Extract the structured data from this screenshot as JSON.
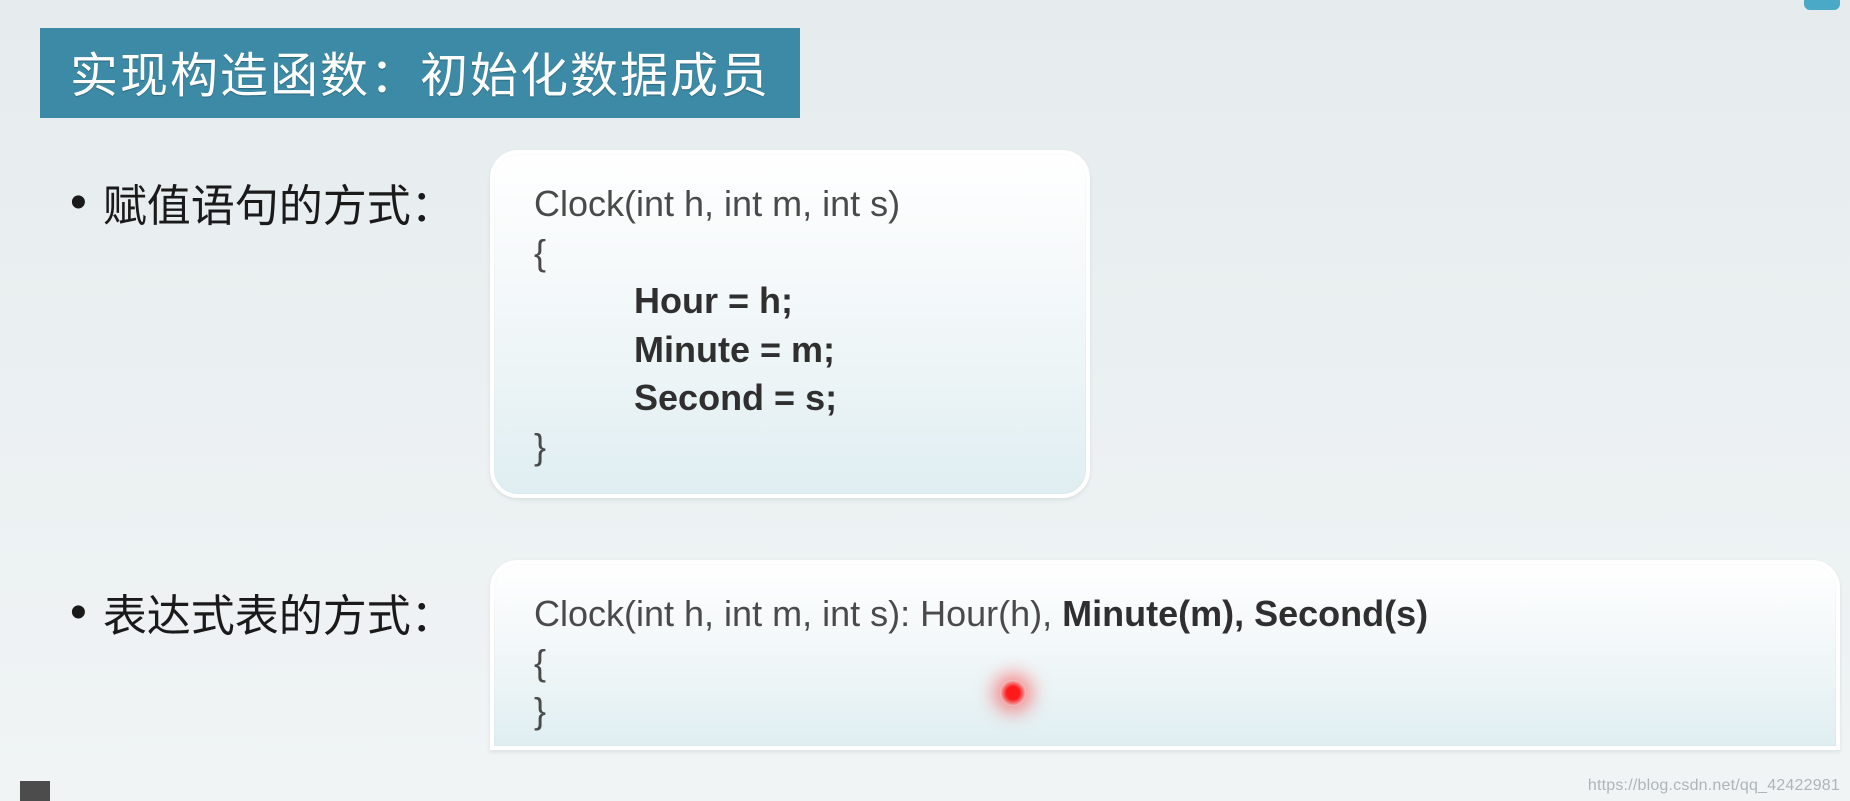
{
  "slide": {
    "title": "实现构造函数：初始化数据成员",
    "bullets": [
      {
        "label": "赋值语句的方式："
      },
      {
        "label": "表达式表的方式："
      }
    ],
    "code1": {
      "ln1": "Clock(int h, int m, int s)",
      "ln2": "{",
      "ln3": "          Hour = h;",
      "ln4": "          Minute = m;",
      "ln5": "          Second = s;",
      "ln6": "}"
    },
    "code2": {
      "ln1_a": "Clock(int h, int m, int s): Hour(h), ",
      "ln1_b": "Minute(m), Second(s)",
      "ln2": "{",
      "ln3": "}"
    },
    "watermark": "https://blog.csdn.net/qq_42422981"
  }
}
